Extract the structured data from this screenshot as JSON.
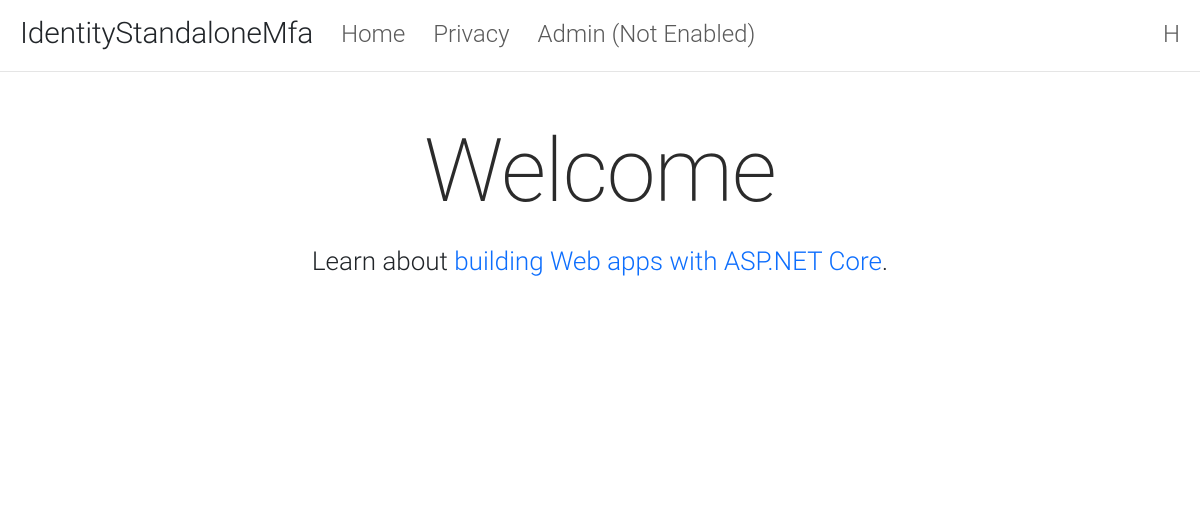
{
  "navbar": {
    "brand": "IdentityStandaloneMfa",
    "links": {
      "home": "Home",
      "privacy": "Privacy",
      "admin": "Admin (Not Enabled)"
    },
    "right": "H"
  },
  "main": {
    "title": "Welcome",
    "lead_prefix": "Learn about ",
    "lead_link": "building Web apps with ASP.NET Core",
    "lead_suffix": "."
  }
}
